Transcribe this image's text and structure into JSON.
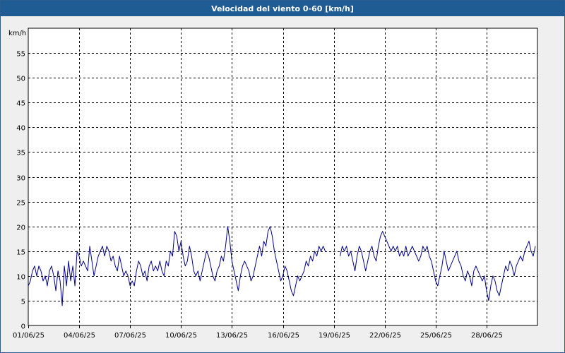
{
  "window": {
    "title": "Velocidad del viento 0-60 [km/h]"
  },
  "chart_data": {
    "type": "line",
    "title": "Velocidad del viento 0-60 [km/h]",
    "ylabel": "km/h",
    "xlabel": "",
    "ylim": [
      0,
      60
    ],
    "xlim": [
      "2025-06-01",
      "2025-07-01"
    ],
    "y_ticks": [
      0,
      5,
      10,
      15,
      20,
      25,
      30,
      35,
      40,
      45,
      50,
      55
    ],
    "x_ticks": [
      "2025-06-01",
      "2025-06-04",
      "2025-06-07",
      "2025-06-10",
      "2025-06-13",
      "2025-06-16",
      "2025-06-19",
      "2025-06-22",
      "2025-06-25",
      "2025-06-28"
    ],
    "x_tick_labels": [
      "01/06/25",
      "04/06/25",
      "07/06/25",
      "10/06/25",
      "13/06/25",
      "16/06/25",
      "19/06/25",
      "22/06/25",
      "25/06/25",
      "28/06/25"
    ],
    "grid": true,
    "colors": {
      "line": "#00008b",
      "grid": "#000000",
      "plot_bg": "#ffffff",
      "title_bg": "#1f5c94"
    },
    "series": [
      {
        "segments": [
          [
            [
              "2025-06-01 00:00",
              8
            ],
            [
              "2025-06-01 03:00",
              9
            ],
            [
              "2025-06-01 06:00",
              11
            ],
            [
              "2025-06-01 09:00",
              12
            ],
            [
              "2025-06-01 12:00",
              10
            ],
            [
              "2025-06-01 15:00",
              12
            ],
            [
              "2025-06-01 18:00",
              11
            ],
            [
              "2025-06-01 21:00",
              9
            ],
            [
              "2025-06-02 00:00",
              10
            ],
            [
              "2025-06-02 03:00",
              8
            ],
            [
              "2025-06-02 06:00",
              11
            ],
            [
              "2025-06-02 09:00",
              12
            ],
            [
              "2025-06-02 12:00",
              10
            ],
            [
              "2025-06-02 15:00",
              7
            ],
            [
              "2025-06-02 18:00",
              11
            ],
            [
              "2025-06-02 21:00",
              9
            ],
            [
              "2025-06-03 00:00",
              4
            ],
            [
              "2025-06-03 03:00",
              12
            ],
            [
              "2025-06-03 06:00",
              8
            ],
            [
              "2025-06-03 09:00",
              13
            ],
            [
              "2025-06-03 12:00",
              9
            ],
            [
              "2025-06-03 15:00",
              12
            ],
            [
              "2025-06-03 18:00",
              8
            ],
            [
              "2025-06-03 21:00",
              15
            ],
            [
              "2025-06-04 00:00",
              14
            ],
            [
              "2025-06-04 03:00",
              12
            ],
            [
              "2025-06-04 06:00",
              13
            ],
            [
              "2025-06-04 09:00",
              12
            ],
            [
              "2025-06-04 12:00",
              11
            ],
            [
              "2025-06-04 15:00",
              16
            ],
            [
              "2025-06-04 18:00",
              13
            ],
            [
              "2025-06-04 21:00",
              10
            ],
            [
              "2025-06-05 00:00",
              12
            ],
            [
              "2025-06-05 03:00",
              14
            ],
            [
              "2025-06-05 06:00",
              15
            ],
            [
              "2025-06-05 09:00",
              16
            ],
            [
              "2025-06-05 12:00",
              14
            ],
            [
              "2025-06-05 15:00",
              16
            ],
            [
              "2025-06-05 18:00",
              15
            ],
            [
              "2025-06-05 21:00",
              13
            ],
            [
              "2025-06-06 00:00",
              14
            ],
            [
              "2025-06-06 03:00",
              12
            ],
            [
              "2025-06-06 06:00",
              11
            ],
            [
              "2025-06-06 09:00",
              14
            ],
            [
              "2025-06-06 12:00",
              12
            ],
            [
              "2025-06-06 15:00",
              10
            ],
            [
              "2025-06-06 18:00",
              11
            ],
            [
              "2025-06-06 21:00",
              10
            ],
            [
              "2025-06-07 00:00",
              8
            ],
            [
              "2025-06-07 03:00",
              9
            ],
            [
              "2025-06-07 06:00",
              8
            ],
            [
              "2025-06-07 09:00",
              11
            ],
            [
              "2025-06-07 12:00",
              13
            ],
            [
              "2025-06-07 15:00",
              12
            ],
            [
              "2025-06-07 18:00",
              10
            ],
            [
              "2025-06-07 21:00",
              11
            ],
            [
              "2025-06-08 00:00",
              9
            ],
            [
              "2025-06-08 03:00",
              12
            ],
            [
              "2025-06-08 06:00",
              13
            ],
            [
              "2025-06-08 09:00",
              11
            ],
            [
              "2025-06-08 12:00",
              12
            ],
            [
              "2025-06-08 15:00",
              11
            ],
            [
              "2025-06-08 18:00",
              13
            ],
            [
              "2025-06-08 21:00",
              11
            ],
            [
              "2025-06-09 00:00",
              10
            ],
            [
              "2025-06-09 03:00",
              13
            ],
            [
              "2025-06-09 06:00",
              12
            ],
            [
              "2025-06-09 09:00",
              15
            ],
            [
              "2025-06-09 12:00",
              14
            ],
            [
              "2025-06-09 15:00",
              19
            ],
            [
              "2025-06-09 18:00",
              18
            ],
            [
              "2025-06-09 21:00",
              15
            ],
            [
              "2025-06-10 00:00",
              17
            ],
            [
              "2025-06-10 03:00",
              14
            ],
            [
              "2025-06-10 06:00",
              12
            ],
            [
              "2025-06-10 09:00",
              13
            ],
            [
              "2025-06-10 12:00",
              16
            ],
            [
              "2025-06-10 15:00",
              14
            ],
            [
              "2025-06-10 18:00",
              11
            ],
            [
              "2025-06-10 21:00",
              10
            ],
            [
              "2025-06-11 00:00",
              11
            ],
            [
              "2025-06-11 03:00",
              9
            ],
            [
              "2025-06-11 06:00",
              11
            ],
            [
              "2025-06-11 09:00",
              13
            ],
            [
              "2025-06-11 12:00",
              15
            ],
            [
              "2025-06-11 15:00",
              14
            ],
            [
              "2025-06-11 18:00",
              12
            ],
            [
              "2025-06-11 21:00",
              10
            ],
            [
              "2025-06-12 00:00",
              9
            ],
            [
              "2025-06-12 03:00",
              11
            ],
            [
              "2025-06-12 06:00",
              12
            ],
            [
              "2025-06-12 09:00",
              14
            ],
            [
              "2025-06-12 12:00",
              13
            ],
            [
              "2025-06-12 15:00",
              16
            ],
            [
              "2025-06-12 18:00",
              20
            ],
            [
              "2025-06-12 21:00",
              17
            ],
            [
              "2025-06-13 00:00",
              13
            ],
            [
              "2025-06-13 03:00",
              11
            ],
            [
              "2025-06-13 06:00",
              9
            ],
            [
              "2025-06-13 09:00",
              7
            ],
            [
              "2025-06-13 12:00",
              10
            ],
            [
              "2025-06-13 15:00",
              12
            ],
            [
              "2025-06-13 18:00",
              13
            ],
            [
              "2025-06-13 21:00",
              12
            ],
            [
              "2025-06-14 00:00",
              11
            ],
            [
              "2025-06-14 03:00",
              9
            ],
            [
              "2025-06-14 06:00",
              10
            ],
            [
              "2025-06-14 09:00",
              12
            ],
            [
              "2025-06-14 12:00",
              14
            ],
            [
              "2025-06-14 15:00",
              16
            ],
            [
              "2025-06-14 18:00",
              14
            ],
            [
              "2025-06-14 21:00",
              17
            ],
            [
              "2025-06-15 00:00",
              16
            ],
            [
              "2025-06-15 03:00",
              19
            ],
            [
              "2025-06-15 06:00",
              20
            ],
            [
              "2025-06-15 09:00",
              18
            ],
            [
              "2025-06-15 12:00",
              15
            ],
            [
              "2025-06-15 15:00",
              13
            ],
            [
              "2025-06-15 18:00",
              11
            ],
            [
              "2025-06-15 21:00",
              9
            ],
            [
              "2025-06-16 00:00",
              10
            ],
            [
              "2025-06-16 03:00",
              12
            ],
            [
              "2025-06-16 06:00",
              11
            ],
            [
              "2025-06-16 09:00",
              9
            ],
            [
              "2025-06-16 12:00",
              7
            ],
            [
              "2025-06-16 15:00",
              6
            ],
            [
              "2025-06-16 18:00",
              8
            ],
            [
              "2025-06-16 21:00",
              10
            ],
            [
              "2025-06-17 00:00",
              9
            ],
            [
              "2025-06-17 03:00",
              10
            ],
            [
              "2025-06-17 06:00",
              11
            ],
            [
              "2025-06-17 09:00",
              13
            ],
            [
              "2025-06-17 12:00",
              12
            ],
            [
              "2025-06-17 15:00",
              14
            ],
            [
              "2025-06-17 18:00",
              13
            ],
            [
              "2025-06-17 21:00",
              15
            ],
            [
              "2025-06-18 00:00",
              14
            ],
            [
              "2025-06-18 03:00",
              16
            ],
            [
              "2025-06-18 06:00",
              15
            ],
            [
              "2025-06-18 09:00",
              16
            ],
            [
              "2025-06-18 12:00",
              15
            ]
          ],
          [
            [
              "2025-06-19 09:00",
              14
            ],
            [
              "2025-06-19 12:00",
              16
            ],
            [
              "2025-06-19 15:00",
              15
            ],
            [
              "2025-06-19 18:00",
              16
            ],
            [
              "2025-06-19 21:00",
              14
            ],
            [
              "2025-06-20 00:00",
              15
            ],
            [
              "2025-06-20 03:00",
              13
            ],
            [
              "2025-06-20 06:00",
              11
            ],
            [
              "2025-06-20 09:00",
              14
            ],
            [
              "2025-06-20 12:00",
              16
            ],
            [
              "2025-06-20 15:00",
              15
            ],
            [
              "2025-06-20 18:00",
              13
            ],
            [
              "2025-06-20 21:00",
              11
            ],
            [
              "2025-06-21 00:00",
              13
            ],
            [
              "2025-06-21 03:00",
              15
            ],
            [
              "2025-06-21 06:00",
              16
            ],
            [
              "2025-06-21 09:00",
              14
            ],
            [
              "2025-06-21 12:00",
              13
            ],
            [
              "2025-06-21 15:00",
              16
            ],
            [
              "2025-06-21 18:00",
              18
            ],
            [
              "2025-06-21 21:00",
              19
            ],
            [
              "2025-06-22 00:00",
              18
            ],
            [
              "2025-06-22 03:00",
              17
            ],
            [
              "2025-06-22 06:00",
              16
            ],
            [
              "2025-06-22 09:00",
              15
            ],
            [
              "2025-06-22 12:00",
              16
            ],
            [
              "2025-06-22 15:00",
              15
            ],
            [
              "2025-06-22 18:00",
              16
            ],
            [
              "2025-06-22 21:00",
              14
            ],
            [
              "2025-06-23 00:00",
              15
            ],
            [
              "2025-06-23 03:00",
              14
            ],
            [
              "2025-06-23 06:00",
              16
            ],
            [
              "2025-06-23 09:00",
              14
            ],
            [
              "2025-06-23 12:00",
              15
            ],
            [
              "2025-06-23 15:00",
              16
            ],
            [
              "2025-06-23 18:00",
              15
            ],
            [
              "2025-06-23 21:00",
              14
            ],
            [
              "2025-06-24 00:00",
              13
            ],
            [
              "2025-06-24 03:00",
              14
            ],
            [
              "2025-06-24 06:00",
              16
            ],
            [
              "2025-06-24 09:00",
              15
            ],
            [
              "2025-06-24 12:00",
              16
            ],
            [
              "2025-06-24 15:00",
              14
            ],
            [
              "2025-06-24 18:00",
              13
            ],
            [
              "2025-06-24 21:00",
              11
            ],
            [
              "2025-06-25 00:00",
              9
            ],
            [
              "2025-06-25 03:00",
              8
            ],
            [
              "2025-06-25 06:00",
              10
            ],
            [
              "2025-06-25 09:00",
              12
            ],
            [
              "2025-06-25 12:00",
              15
            ],
            [
              "2025-06-25 15:00",
              13
            ],
            [
              "2025-06-25 18:00",
              11
            ],
            [
              "2025-06-25 21:00",
              12
            ],
            [
              "2025-06-26 00:00",
              13
            ],
            [
              "2025-06-26 03:00",
              14
            ],
            [
              "2025-06-26 06:00",
              15
            ],
            [
              "2025-06-26 09:00",
              13
            ],
            [
              "2025-06-26 12:00",
              12
            ],
            [
              "2025-06-26 15:00",
              10
            ],
            [
              "2025-06-26 18:00",
              9
            ],
            [
              "2025-06-26 21:00",
              11
            ],
            [
              "2025-06-27 00:00",
              10
            ],
            [
              "2025-06-27 03:00",
              8
            ],
            [
              "2025-06-27 06:00",
              11
            ],
            [
              "2025-06-27 09:00",
              12
            ],
            [
              "2025-06-27 12:00",
              11
            ],
            [
              "2025-06-27 15:00",
              10
            ],
            [
              "2025-06-27 18:00",
              9
            ],
            [
              "2025-06-27 21:00",
              10
            ],
            [
              "2025-06-28 00:00",
              7
            ],
            [
              "2025-06-28 03:00",
              5
            ],
            [
              "2025-06-28 06:00",
              8
            ],
            [
              "2025-06-28 09:00",
              10
            ],
            [
              "2025-06-28 12:00",
              9
            ],
            [
              "2025-06-28 15:00",
              7
            ],
            [
              "2025-06-28 18:00",
              6
            ],
            [
              "2025-06-28 21:00",
              8
            ],
            [
              "2025-06-29 00:00",
              10
            ],
            [
              "2025-06-29 03:00",
              12
            ],
            [
              "2025-06-29 06:00",
              11
            ],
            [
              "2025-06-29 09:00",
              13
            ],
            [
              "2025-06-29 12:00",
              12
            ],
            [
              "2025-06-29 15:00",
              10
            ],
            [
              "2025-06-29 18:00",
              12
            ],
            [
              "2025-06-29 21:00",
              13
            ],
            [
              "2025-06-30 00:00",
              14
            ],
            [
              "2025-06-30 03:00",
              13
            ],
            [
              "2025-06-30 06:00",
              15
            ],
            [
              "2025-06-30 09:00",
              16
            ],
            [
              "2025-06-30 12:00",
              17
            ],
            [
              "2025-06-30 15:00",
              15
            ],
            [
              "2025-06-30 18:00",
              14
            ],
            [
              "2025-06-30 21:00",
              16
            ]
          ]
        ]
      }
    ]
  }
}
